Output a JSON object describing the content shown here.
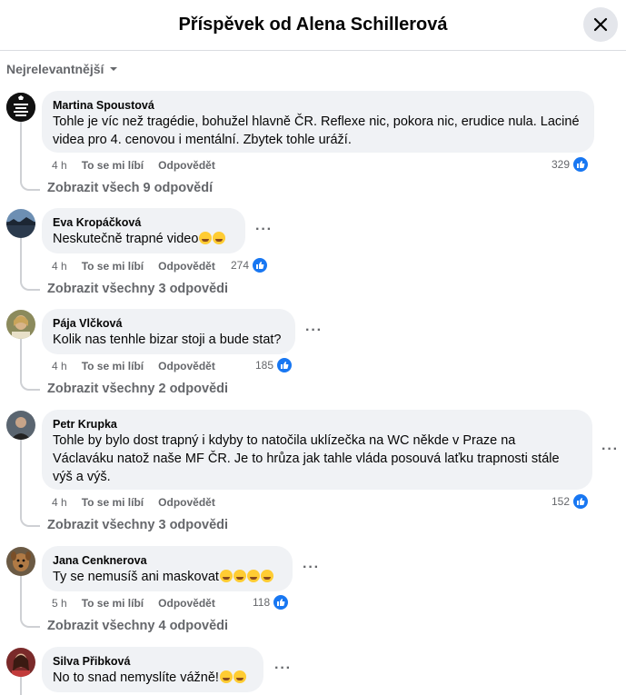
{
  "header": {
    "title": "Příspěvek od Alena Schillerová",
    "close_icon": "close-icon"
  },
  "sort": {
    "label": "Nejrelevantnější",
    "icon": "caret-down-icon"
  },
  "action_labels": {
    "like": "To se mi líbí",
    "reply": "Odpovědět"
  },
  "comments": [
    {
      "author": "Martina Spoustová",
      "lines": [
        "Tohle je víc než tragédie, bohužel hlavně ČR. Reflexe nic, pokora nic, erudice nula. Laciné",
        "videa pro 4. cenovou i mentální. Zbytek tohle uráží."
      ],
      "time": "4 h",
      "likes": "329",
      "replies": "Zobrazit všech 9 odpovědí",
      "avatar": "keep-calm-avatar"
    },
    {
      "author": "Eva Kropáčková",
      "lines": [
        "Neskutečně trapné video"
      ],
      "time": "4 h",
      "likes": "274",
      "replies": "Zobrazit všechny 3 odpovědi",
      "avatar": "landscape-avatar"
    },
    {
      "author": "Pája Vlčková",
      "lines": [
        "Kolik nas tenhle bizar stoji a bude stat?"
      ],
      "time": "4 h",
      "likes": "185",
      "replies": "Zobrazit všechny 2 odpovědi",
      "avatar": "woman-avatar"
    },
    {
      "author": "Petr Krupka",
      "lines": [
        "Tohle by bylo dost trapný i kdyby to natočila uklízečka na WC někde v Praze na",
        "Václaváku natož naše MF ČR. Je to hrůza jak tahle vláda posouvá laťku trapnosti stále",
        "výš a výš."
      ],
      "time": "4 h",
      "likes": "152",
      "replies": "Zobrazit všechny 3 odpovědi",
      "avatar": "man-avatar"
    },
    {
      "author": "Jana Cenknerova",
      "lines": [
        "Ty se nemusíš ani maskovat"
      ],
      "time": "5 h",
      "likes": "118",
      "replies": "Zobrazit všechny 4 odpovědi",
      "avatar": "dog-avatar"
    },
    {
      "author": "Silva Přibková",
      "lines": [
        "No to snad nemyslíte vážně!"
      ],
      "avatar": "woman-red-avatar"
    }
  ],
  "colors": {
    "accent": "#1877f2",
    "bubble": "#f0f2f5",
    "muted": "#65676b"
  }
}
